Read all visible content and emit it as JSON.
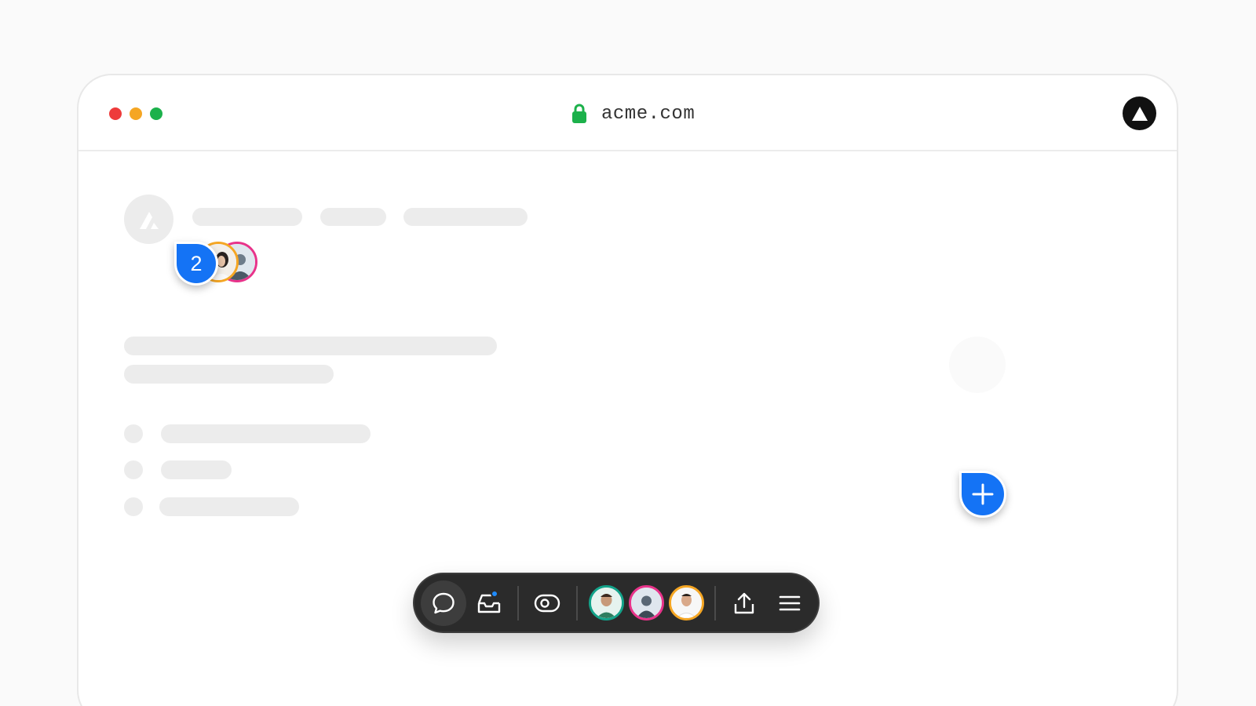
{
  "browser": {
    "url": "acme.com",
    "lock_icon": "lock-icon",
    "logo_icon": "vercel-triangle-icon"
  },
  "comment_pins": [
    {
      "label": "2",
      "color": "#1473f5",
      "avatars": [
        "avatar-orange-ring",
        "avatar-pink-ring"
      ]
    },
    {
      "label": "+",
      "color": "#1473f5"
    }
  ],
  "toolbar": {
    "buttons": [
      {
        "name": "comment",
        "icon": "comment-bubble-icon",
        "active": true
      },
      {
        "name": "inbox",
        "icon": "inbox-icon",
        "has_notification": true
      },
      {
        "name": "view",
        "icon": "eye-toggle-icon"
      },
      {
        "name": "share",
        "icon": "share-upload-icon"
      },
      {
        "name": "menu",
        "icon": "hamburger-menu-icon"
      }
    ],
    "collaborators": [
      {
        "ring_color": "#13a38a"
      },
      {
        "ring_color": "#e8338a"
      },
      {
        "ring_color": "#f5a623"
      }
    ]
  },
  "colors": {
    "accent": "#1473f5",
    "toolbar_bg": "#2b2b2b",
    "skeleton": "#ececec"
  }
}
